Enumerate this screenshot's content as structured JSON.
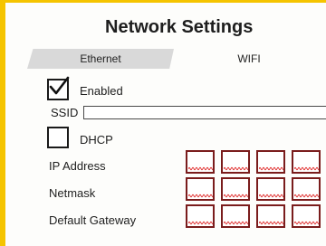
{
  "window": {
    "title": "Network Settings"
  },
  "tabs": [
    {
      "label": "Ethernet",
      "selected": true
    },
    {
      "label": "WIFI",
      "selected": false
    }
  ],
  "enabled": {
    "label": "Enabled",
    "checked": true
  },
  "ssid": {
    "label": "SSID",
    "value": ""
  },
  "dhcp": {
    "label": "DHCP",
    "checked": false
  },
  "fields": {
    "ip_address": {
      "label": "IP Address",
      "octets": [
        "",
        "",
        "",
        ""
      ]
    },
    "netmask": {
      "label": "Netmask",
      "octets": [
        "",
        "",
        "",
        ""
      ]
    },
    "gateway": {
      "label": "Default Gateway",
      "octets": [
        "",
        "",
        "",
        ""
      ]
    }
  },
  "colors": {
    "accent": "#f5c400",
    "tab_selected": "#d9d9d9",
    "octet_border": "#7a1c1c",
    "invalid_underline": "#e03030"
  },
  "icons": {
    "enabled_check": "checkmark-icon"
  }
}
